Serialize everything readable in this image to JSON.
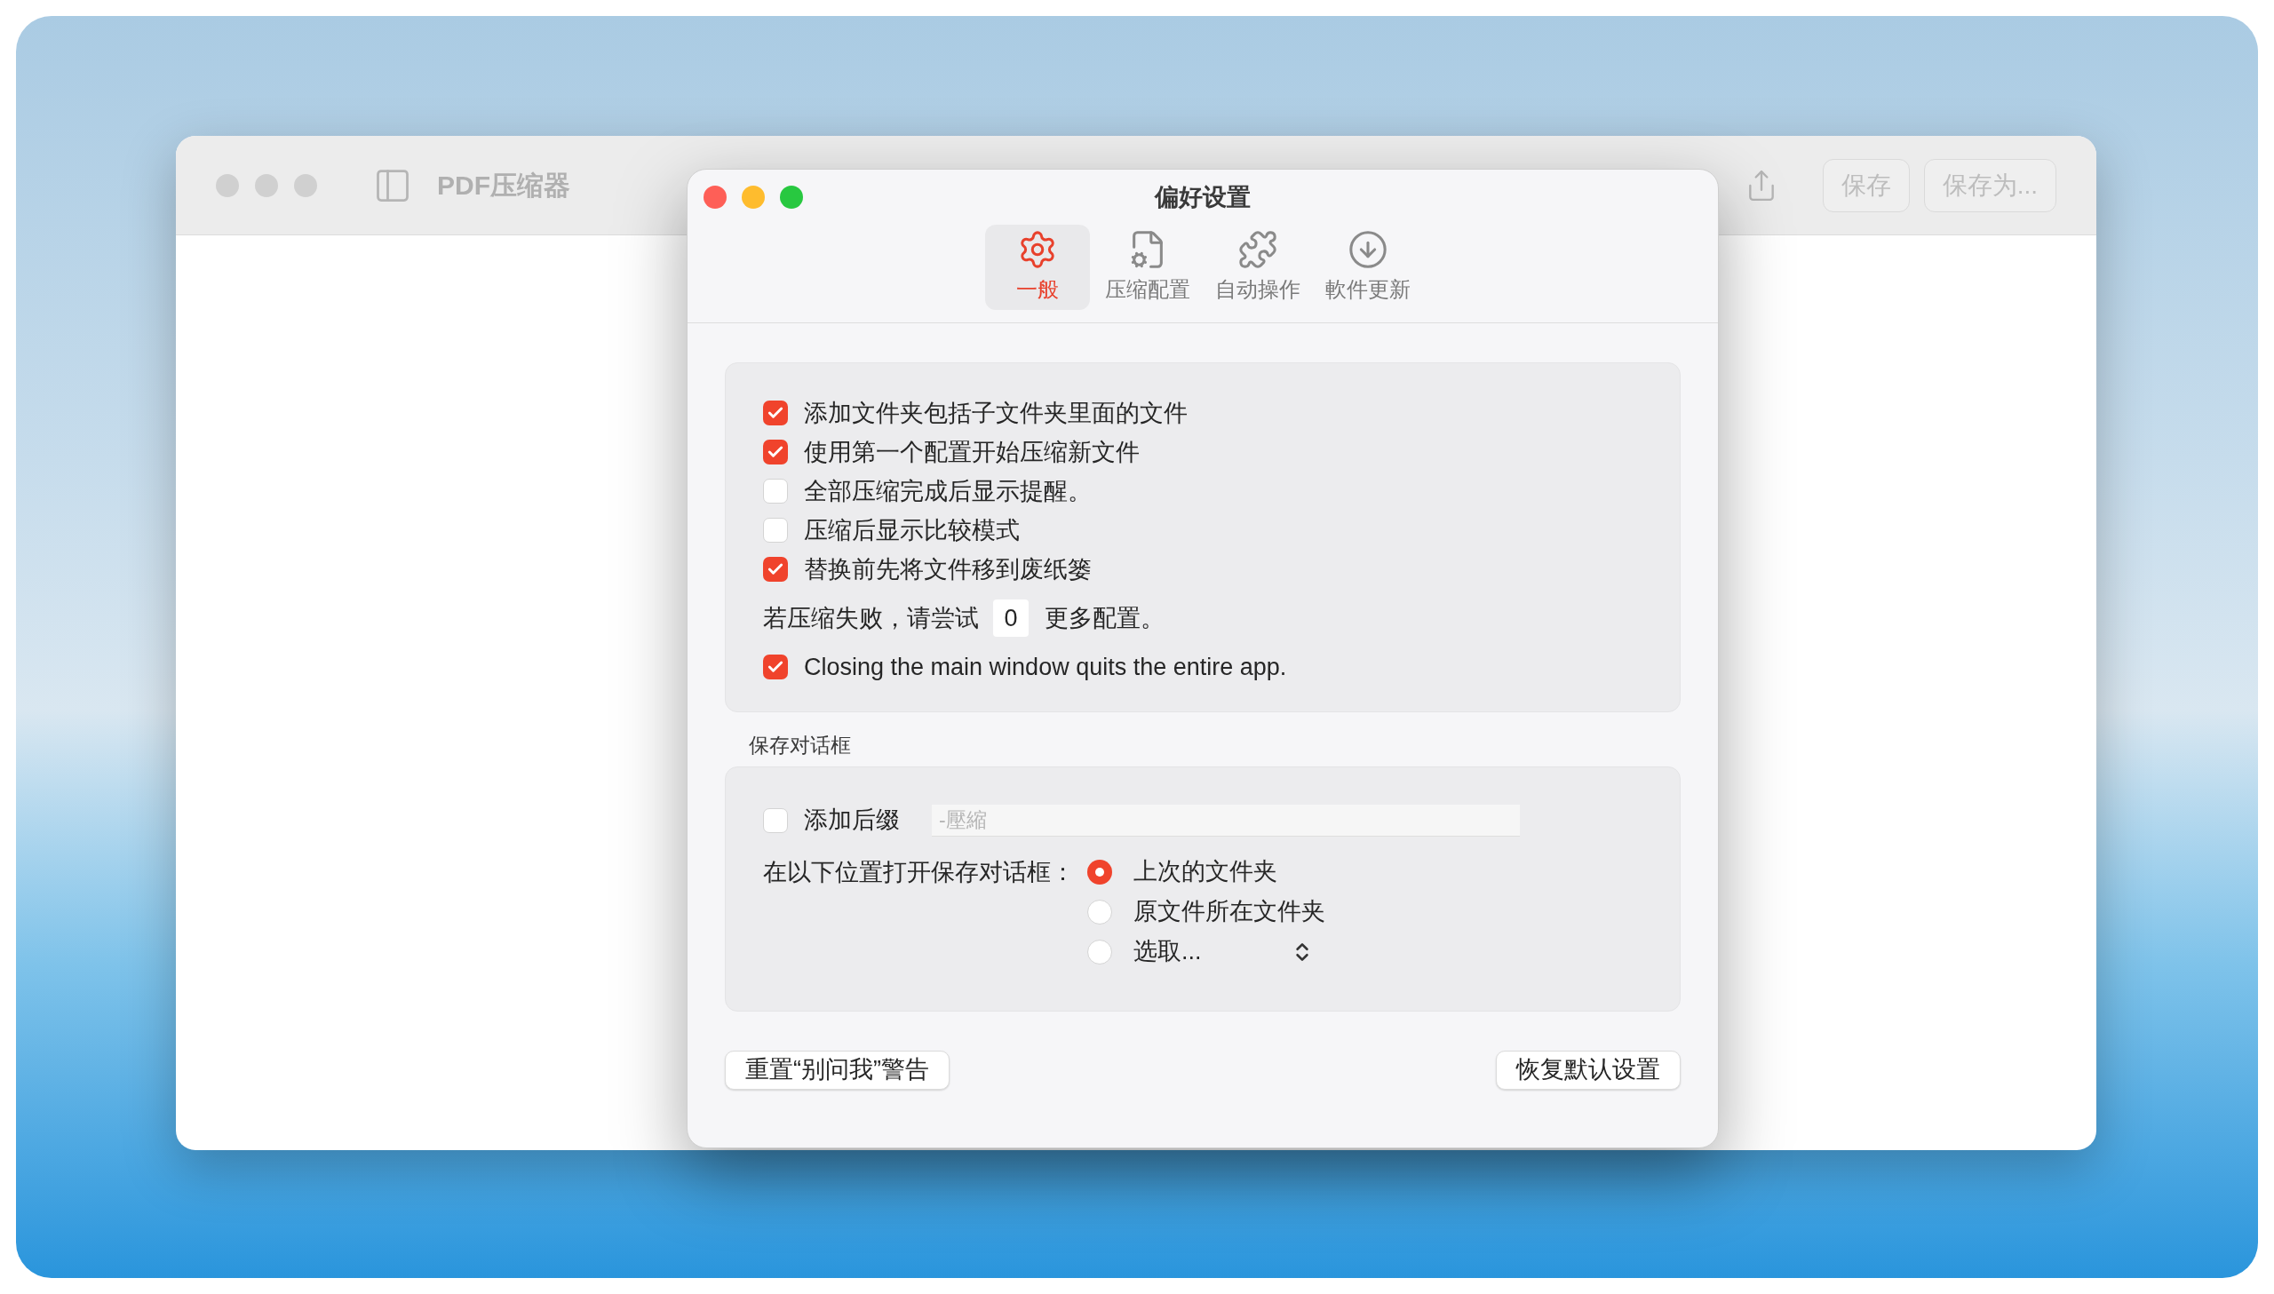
{
  "main_window": {
    "title": "PDF压缩器",
    "toolbar_buttons": [
      {
        "label": "保存"
      },
      {
        "label": "保存为..."
      }
    ]
  },
  "dialog": {
    "title": "偏好设置",
    "tabs": [
      {
        "label": "一般",
        "selected": true
      },
      {
        "label": "压缩配置",
        "selected": false
      },
      {
        "label": "自动操作",
        "selected": false
      },
      {
        "label": "軟件更新",
        "selected": false
      }
    ],
    "options": [
      {
        "kind": "checkbox",
        "label": "添加文件夹包括子文件夹里面的文件",
        "checked": true
      },
      {
        "kind": "checkbox",
        "label": "使用第一个配置开始压缩新文件",
        "checked": true
      },
      {
        "kind": "checkbox",
        "label": "全部压缩完成后显示提醒。",
        "checked": false
      },
      {
        "kind": "checkbox",
        "label": "压缩后显示比较模式",
        "checked": false
      },
      {
        "kind": "checkbox",
        "label": "替换前先将文件移到废纸篓",
        "checked": true
      },
      {
        "kind": "number",
        "before": "若压缩失败，请尝试",
        "value": "0",
        "after": "更多配置。"
      },
      {
        "kind": "checkbox",
        "label": "Closing the main window quits the entire app.",
        "checked": true
      }
    ],
    "save_dialog": {
      "heading": "保存对话框",
      "suffix": {
        "label": "添加后缀",
        "checked": false,
        "placeholder": "-壓縮"
      },
      "location_label": "在以下位置打开保存对话框：",
      "locations": [
        {
          "label": "上次的文件夹",
          "selected": true,
          "kind": "plain"
        },
        {
          "label": "原文件所在文件夹",
          "selected": false,
          "kind": "plain"
        },
        {
          "label": "选取...",
          "selected": false,
          "kind": "popup"
        }
      ]
    },
    "buttons": [
      "重置“别问我”警告",
      "恢复默认设置"
    ]
  }
}
